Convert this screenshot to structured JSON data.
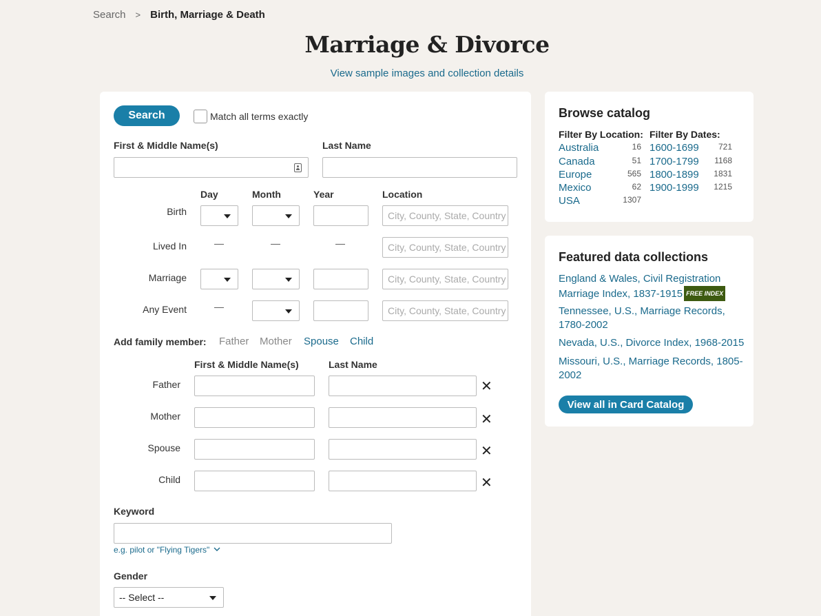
{
  "breadcrumb": {
    "search": "Search",
    "sep": ">",
    "current": "Birth, Marriage & Death"
  },
  "page": {
    "title": "Marriage & Divorce",
    "sample_link": "View sample images and collection details"
  },
  "form": {
    "search_label": "Search",
    "match_exact_label": "Match all terms exactly",
    "first_name_label": "First & Middle Name(s)",
    "last_name_label": "Last Name",
    "col_day": "Day",
    "col_month": "Month",
    "col_year": "Year",
    "col_location": "Location",
    "location_placeholder": "City, County, State, Country",
    "events": {
      "birth": "Birth",
      "lived_in": "Lived In",
      "marriage": "Marriage",
      "any_event": "Any Event"
    },
    "dash": "—",
    "add_family_label": "Add family member:",
    "family_links": {
      "father": "Father",
      "mother": "Mother",
      "spouse": "Spouse",
      "child": "Child"
    },
    "family_first_label": "First & Middle Name(s)",
    "family_last_label": "Last Name",
    "family_rows": {
      "father": "Father",
      "mother": "Mother",
      "spouse": "Spouse",
      "child": "Child"
    },
    "remove_icon": "✕",
    "keyword_label": "Keyword",
    "keyword_hint": "e.g. pilot or \"Flying Tigers\"",
    "gender_label": "Gender",
    "gender_value": "-- Select --"
  },
  "browse": {
    "title": "Browse catalog",
    "location_head": "Filter By Location:",
    "dates_head": "Filter By Dates:",
    "locations": [
      {
        "name": "Australia",
        "count": "16"
      },
      {
        "name": "Canada",
        "count": "51"
      },
      {
        "name": "Europe",
        "count": "565"
      },
      {
        "name": "Mexico",
        "count": "62"
      },
      {
        "name": "USA",
        "count": "1307"
      }
    ],
    "dates": [
      {
        "name": "1600-1699",
        "count": "721"
      },
      {
        "name": "1700-1799",
        "count": "1168"
      },
      {
        "name": "1800-1899",
        "count": "1831"
      },
      {
        "name": "1900-1999",
        "count": "1215"
      }
    ]
  },
  "featured": {
    "title": "Featured data collections",
    "items": [
      {
        "line1": "England & Wales, Civil Registration",
        "line2": "Marriage Index, 1837-1915",
        "badge": "FREE INDEX"
      },
      {
        "line1": "Tennessee, U.S., Marriage Records,",
        "line2": "1780-2002"
      },
      {
        "line1": "Nevada, U.S., Divorce Index, 1968-2015"
      },
      {
        "line1": "Missouri, U.S., Marriage Records, 1805-",
        "line2": "2002"
      }
    ],
    "view_all": "View all in Card Catalog"
  },
  "colors": {
    "accent": "#1a7fa8",
    "link": "#1a6a8c",
    "background": "#f4f1ed",
    "badge": "#3d5a10"
  }
}
